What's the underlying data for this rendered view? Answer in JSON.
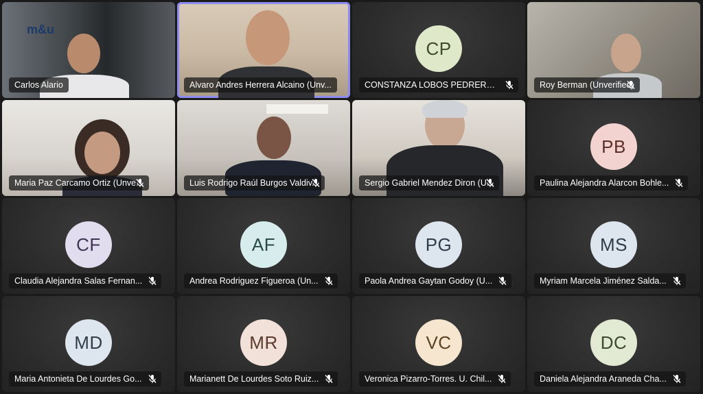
{
  "participants": [
    {
      "name": "Carlos Alario",
      "type": "video",
      "muted": false
    },
    {
      "name": "Alvaro Andres Herrera Alcaino (Unv...",
      "type": "video",
      "muted": false,
      "active": true
    },
    {
      "name": "CONSTANZA LOBOS PEDRERO...",
      "type": "avatar",
      "initials": "CP",
      "avatar_color": "#dfe8c9",
      "text_color": "#3f4a2c",
      "muted": true
    },
    {
      "name": "Roy Berman (Unverified)",
      "type": "video",
      "muted": true
    },
    {
      "name": "Maria Paz Carcamo Ortiz (Unve...",
      "type": "video",
      "muted": true
    },
    {
      "name": "Luis Rodrigo Raúl Burgos Valdiv...",
      "type": "video",
      "muted": true
    },
    {
      "name": "Sergio Gabriel Mendez Diron (U...",
      "type": "video",
      "muted": true
    },
    {
      "name": "Paulina Alejandra Alarcon Bohle...",
      "type": "avatar",
      "initials": "PB",
      "avatar_color": "#f3d3d0",
      "text_color": "#5c2e2a",
      "muted": true
    },
    {
      "name": "Claudia Alejandra Salas Fernan...",
      "type": "avatar",
      "initials": "CF",
      "avatar_color": "#e2dcef",
      "text_color": "#3d3553",
      "muted": true
    },
    {
      "name": "Andrea Rodriguez Figueroa (Un...",
      "type": "avatar",
      "initials": "AF",
      "avatar_color": "#d7ecec",
      "text_color": "#2b4a4a",
      "muted": true
    },
    {
      "name": "Paola Andrea Gaytan Godoy (U...",
      "type": "avatar",
      "initials": "PG",
      "avatar_color": "#dde6ee",
      "text_color": "#2f3d4b",
      "muted": true
    },
    {
      "name": "Myriam Marcela Jiménez Salda...",
      "type": "avatar",
      "initials": "MS",
      "avatar_color": "#dde6ee",
      "text_color": "#2f3d4b",
      "muted": true
    },
    {
      "name": "Maria Antonieta De Lourdes Go...",
      "type": "avatar",
      "initials": "MD",
      "avatar_color": "#dde6ee",
      "text_color": "#2f3d4b",
      "muted": true
    },
    {
      "name": "Marianett De Lourdes Soto Ruiz...",
      "type": "avatar",
      "initials": "MR",
      "avatar_color": "#f2e1d8",
      "text_color": "#5a3a2c",
      "muted": true
    },
    {
      "name": "Veronica Pizarro-Torres. U. Chil...",
      "type": "avatar",
      "initials": "VC",
      "avatar_color": "#f6e6d0",
      "text_color": "#5b4323",
      "muted": true
    },
    {
      "name": "Daniela Alejandra Araneda Cha...",
      "type": "avatar",
      "initials": "DC",
      "avatar_color": "#e2ead4",
      "text_color": "#3b4a2a",
      "muted": true
    }
  ],
  "logo_text": "m&u"
}
